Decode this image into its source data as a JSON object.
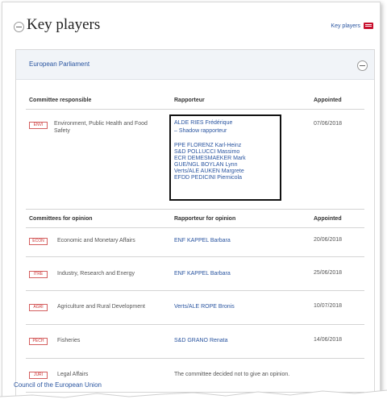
{
  "header": {
    "title": "Key players",
    "link": "Key players"
  },
  "panel": {
    "title": "European Parliament"
  },
  "responsible": {
    "col_committee": "Committee responsible",
    "col_rapporteur": "Rapporteur",
    "col_appointed": "Appointed",
    "tag": "ENVI",
    "committee": "Environment, Public Health and Food Safety",
    "rapporteur": "ALDE RIES Frédérique",
    "shadow": "– Shadow rapporteur",
    "shadows": [
      "PPE FLORENZ Karl-Heinz",
      "S&D POLLUCCI Massimo",
      "ECR DEMESMAEKER Mark",
      "GUE/NGL BOYLAN Lynn",
      "Verts/ALE AUKEN Margrete",
      "EFDD PEDICINI Piernicola"
    ],
    "appointed": "07/06/2018"
  },
  "opinion": {
    "col_committee": "Committees for opinion",
    "col_rapporteur": "Rapporteur for opinion",
    "col_appointed": "Appointed",
    "rows": [
      {
        "tag": "ECON",
        "committee": "Economic and Monetary Affairs",
        "rapporteur": "ENF KAPPEL Barbara",
        "appointed": "20/06/2018"
      },
      {
        "tag": "ITRE",
        "committee": "Industry, Research and Energy",
        "rapporteur": "ENF KAPPEL Barbara",
        "appointed": "25/06/2018"
      },
      {
        "tag": "AGRI",
        "committee": "Agriculture and Rural Development",
        "rapporteur": "Verts/ALE ROPE Bronis",
        "appointed": "10/07/2018"
      },
      {
        "tag": "PECH",
        "committee": "Fisheries",
        "rapporteur": "S&D GRANO Renata",
        "appointed": "14/06/2018"
      },
      {
        "tag": "JURI",
        "committee": "Legal Affairs",
        "rapporteur": "The committee decided not to give an opinion.",
        "appointed": ""
      }
    ]
  },
  "footer": {
    "council": "Council of the European Union"
  }
}
